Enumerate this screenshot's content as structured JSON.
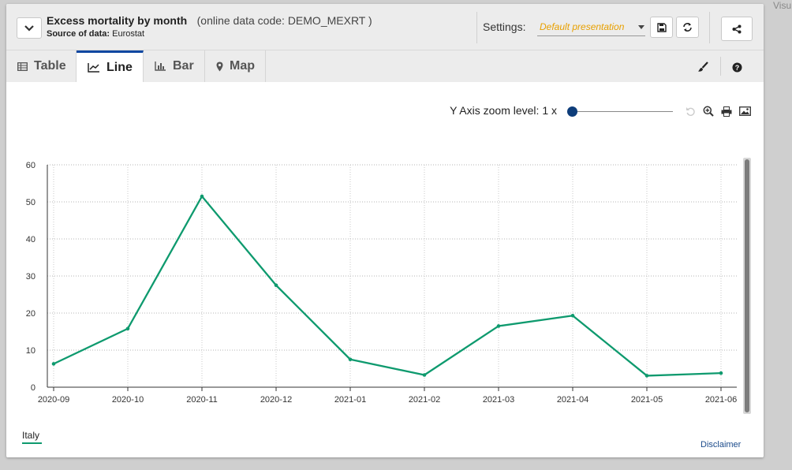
{
  "outside": {
    "text": "Visu"
  },
  "header": {
    "title": "Excess mortality by month",
    "code": "(online data code: DEMO_MEXRT )",
    "source_label": "Source of data:",
    "source_value": "Eurostat",
    "settings_label": "Settings:",
    "settings_value": "Default presentation"
  },
  "tabs": [
    {
      "label": "Table",
      "icon": "table-icon"
    },
    {
      "label": "Line",
      "icon": "line-chart-icon"
    },
    {
      "label": "Bar",
      "icon": "bar-chart-icon"
    },
    {
      "label": "Map",
      "icon": "map-marker-icon"
    }
  ],
  "toolbar": {
    "zoom_label": "Y Axis zoom level: 1 x",
    "zoom_level": 1
  },
  "footer": {
    "disclaimer": "Disclaimer"
  },
  "colors": {
    "series": "#0e9a6e",
    "accent": "#0e47a1",
    "settings": "#e8a000"
  },
  "chart_data": {
    "type": "line",
    "categories": [
      "2020-09",
      "2020-10",
      "2020-11",
      "2020-12",
      "2021-01",
      "2021-02",
      "2021-03",
      "2021-04",
      "2021-05",
      "2021-06"
    ],
    "series": [
      {
        "name": "Italy",
        "values": [
          6.3,
          15.8,
          51.5,
          27.5,
          7.5,
          3.3,
          16.5,
          19.3,
          3.1,
          3.8
        ],
        "color": "#0e9a6e"
      }
    ],
    "ylim": [
      0,
      60
    ],
    "yticks": [
      0,
      10,
      20,
      30,
      40,
      50,
      60
    ],
    "grid": true,
    "legend": "bottom-left"
  }
}
